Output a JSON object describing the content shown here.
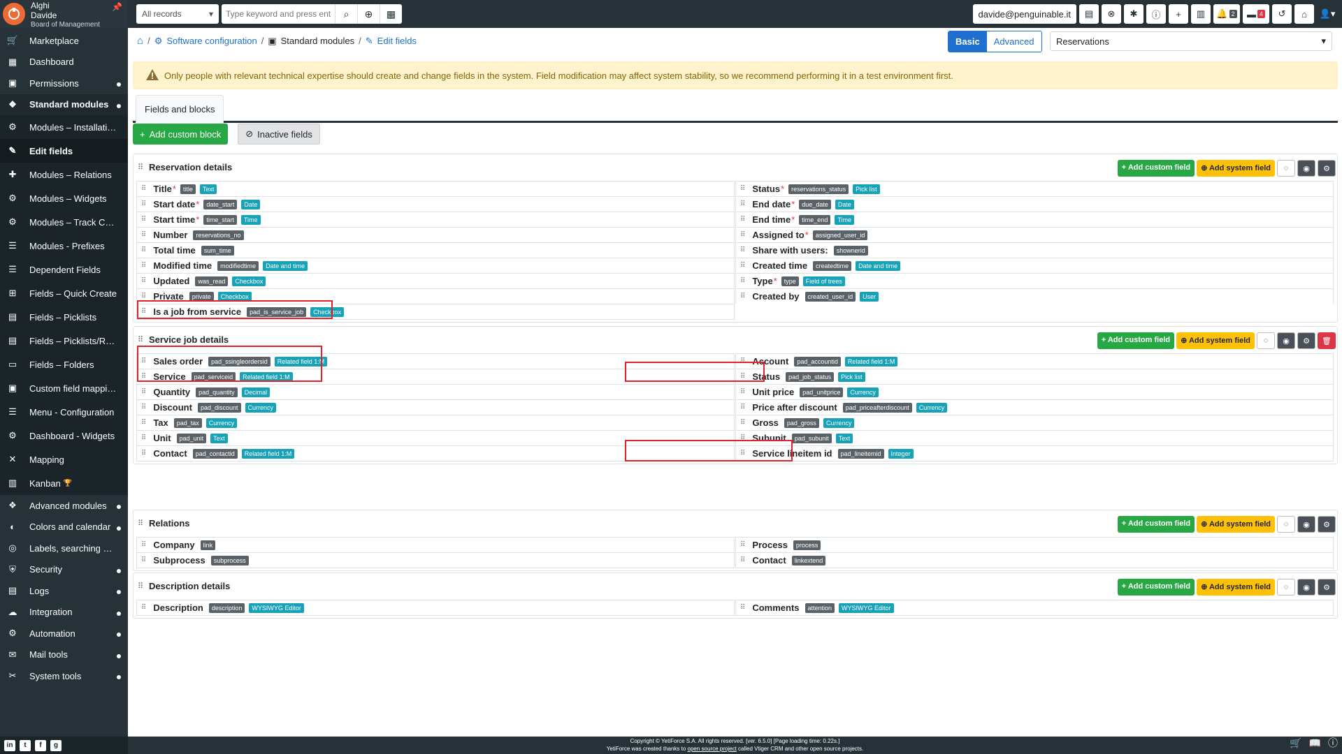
{
  "user": {
    "name1": "Alghi",
    "name2": "Davide",
    "role": "Board of Management"
  },
  "menu": [
    {
      "label": "Marketplace",
      "icon": "cart-icon",
      "dot": false,
      "type": "top"
    },
    {
      "label": "Dashboard",
      "icon": "dashboard-icon",
      "dot": false,
      "type": "top"
    },
    {
      "label": "Permissions",
      "icon": "briefcase-icon",
      "dot": true,
      "type": "top"
    },
    {
      "label": "Standard modules",
      "icon": "modules-icon",
      "dot": true,
      "type": "parent"
    },
    {
      "label": "Modules – Installation",
      "icon": "gear-cube-icon",
      "dot": false,
      "type": "sub"
    },
    {
      "label": "Edit fields",
      "icon": "edit-icon",
      "dot": false,
      "type": "cur"
    },
    {
      "label": "Modules – Relations",
      "icon": "puzzle-icon",
      "dot": false,
      "type": "sub"
    },
    {
      "label": "Modules – Widgets",
      "icon": "widgets-icon",
      "dot": false,
      "type": "sub"
    },
    {
      "label": "Modules – Track Chang…",
      "icon": "track-icon",
      "dot": false,
      "type": "sub"
    },
    {
      "label": "Modules - Prefixes",
      "icon": "prefix-icon",
      "dot": false,
      "type": "sub"
    },
    {
      "label": "Dependent Fields",
      "icon": "list-icon",
      "dot": false,
      "type": "sub"
    },
    {
      "label": "Fields – Quick Create",
      "icon": "plus-square-icon",
      "dot": false,
      "type": "sub"
    },
    {
      "label": "Fields – Picklists",
      "icon": "picklist-icon",
      "dot": false,
      "type": "sub"
    },
    {
      "label": "Fields – Picklists/Relati…",
      "icon": "picklist-relation-icon",
      "dot": false,
      "type": "sub"
    },
    {
      "label": "Fields – Folders",
      "icon": "folder-icon",
      "dot": false,
      "type": "sub"
    },
    {
      "label": "Custom field mapping",
      "icon": "mapping-icon",
      "dot": false,
      "type": "sub"
    },
    {
      "label": "Menu - Configuration",
      "icon": "menu-icon",
      "dot": false,
      "type": "sub"
    },
    {
      "label": "Dashboard - Widgets",
      "icon": "dashboard-widgets-icon",
      "dot": false,
      "type": "sub"
    },
    {
      "label": "Mapping",
      "icon": "arrows-icon",
      "dot": false,
      "type": "sub"
    },
    {
      "label": "Kanban",
      "icon": "kanban-icon",
      "dot": false,
      "type": "sub",
      "extra": "🏆"
    },
    {
      "label": "Advanced modules",
      "icon": "advanced-modules-icon",
      "dot": true,
      "type": "top"
    },
    {
      "label": "Colors and calendar",
      "icon": "palette-icon",
      "dot": true,
      "type": "top"
    },
    {
      "label": "Labels, searching a…",
      "icon": "labels-icon",
      "dot": false,
      "type": "top"
    },
    {
      "label": "Security",
      "icon": "shield-icon",
      "dot": true,
      "type": "top"
    },
    {
      "label": "Logs",
      "icon": "logs-icon",
      "dot": true,
      "type": "top"
    },
    {
      "label": "Integration",
      "icon": "cloud-icon",
      "dot": true,
      "type": "top"
    },
    {
      "label": "Automation",
      "icon": "gears-icon",
      "dot": true,
      "type": "top"
    },
    {
      "label": "Mail tools",
      "icon": "mail-icon",
      "dot": true,
      "type": "top"
    },
    {
      "label": "System tools",
      "icon": "tools-icon",
      "dot": true,
      "type": "top"
    }
  ],
  "topbar": {
    "records": "All records",
    "search_placeholder": "Type keyword and press enter",
    "email": "davide@penguinable.it",
    "notif_count": "2",
    "cal_count": "4"
  },
  "breadcrumb": {
    "l1": "Software configuration",
    "l2": "Standard modules",
    "l3": "Edit fields"
  },
  "mode": {
    "basic": "Basic",
    "advanced": "Advanced"
  },
  "module_select": "Reservations",
  "alert": "Only people with relevant technical expertise should create and change fields in the system. Field modification may affect system stability, so we recommend performing it in a test environment first.",
  "tab": "Fields and blocks",
  "actions": {
    "add_block": "Add custom block",
    "inactive": "Inactive fields"
  },
  "btn": {
    "custom": "Add custom field",
    "system": "Add system field"
  },
  "blocks": [
    {
      "title": "Reservation details",
      "del": false,
      "rows": [
        [
          {
            "n": "Title",
            "r": true,
            "c": "title",
            "t": "Text"
          },
          {
            "n": "Status",
            "r": true,
            "c": "reservations_status",
            "t": "Pick list"
          }
        ],
        [
          {
            "n": "Start date",
            "r": true,
            "c": "date_start",
            "t": "Date"
          },
          {
            "n": "End date",
            "r": true,
            "c": "due_date",
            "t": "Date"
          }
        ],
        [
          {
            "n": "Start time",
            "r": true,
            "c": "time_start",
            "t": "Time"
          },
          {
            "n": "End time",
            "r": true,
            "c": "time_end",
            "t": "Time"
          }
        ],
        [
          {
            "n": "Number",
            "r": false,
            "c": "reservations_no",
            "t": ""
          },
          {
            "n": "Assigned to",
            "r": true,
            "c": "assigned_user_id",
            "t": ""
          }
        ],
        [
          {
            "n": "Total time",
            "r": false,
            "c": "sum_time",
            "t": ""
          },
          {
            "n": "Share with users:",
            "r": false,
            "c": "shownerid",
            "t": ""
          }
        ],
        [
          {
            "n": "Modified time",
            "r": false,
            "c": "modifiedtime",
            "t": "Date and time"
          },
          {
            "n": "Created time",
            "r": false,
            "c": "createdtime",
            "t": "Date and time"
          }
        ],
        [
          {
            "n": "Updated",
            "r": false,
            "c": "was_read",
            "t": "Checkbox"
          },
          {
            "n": "Type",
            "r": true,
            "c": "type",
            "t": "Field of trees"
          }
        ],
        [
          {
            "n": "Private",
            "r": false,
            "c": "private",
            "t": "Checkbox"
          },
          {
            "n": "Created by",
            "r": false,
            "c": "created_user_id",
            "t": "User"
          }
        ],
        [
          {
            "n": "Is a job from service",
            "r": false,
            "c": "pad_is_service_job",
            "t": "Checkbox"
          },
          null
        ]
      ]
    },
    {
      "title": "Service job details",
      "del": true,
      "rows": [
        [
          {
            "n": "Sales order",
            "r": false,
            "c": "pad_ssingleordersid",
            "t": "Related field 1:M"
          },
          {
            "n": "Account",
            "r": false,
            "c": "pad_accountid",
            "t": "Related field 1:M"
          }
        ],
        [
          {
            "n": "Service",
            "r": false,
            "c": "pad_serviceid",
            "t": "Related field 1:M"
          },
          {
            "n": "Status",
            "r": false,
            "c": "pad_job_status",
            "t": "Pick list"
          }
        ],
        [
          {
            "n": "Quantity",
            "r": false,
            "c": "pad_quantity",
            "t": "Decimal"
          },
          {
            "n": "Unit price",
            "r": false,
            "c": "pad_unitprice",
            "t": "Currency"
          }
        ],
        [
          {
            "n": "Discount",
            "r": false,
            "c": "pad_discount",
            "t": "Currency"
          },
          {
            "n": "Price after discount",
            "r": false,
            "c": "pad_priceafterdiscount",
            "t": "Currency"
          }
        ],
        [
          {
            "n": "Tax",
            "r": false,
            "c": "pad_tax",
            "t": "Currency"
          },
          {
            "n": "Gross",
            "r": false,
            "c": "pad_gross",
            "t": "Currency"
          }
        ],
        [
          {
            "n": "Unit",
            "r": false,
            "c": "pad_unit",
            "t": "Text"
          },
          {
            "n": "Subunit",
            "r": false,
            "c": "pad_subunit",
            "t": "Text"
          }
        ],
        [
          {
            "n": "Contact",
            "r": false,
            "c": "pad_contactid",
            "t": "Related field 1:M"
          },
          {
            "n": "Service lineitem id",
            "r": false,
            "c": "pad_lineitemid",
            "t": "Integer"
          }
        ]
      ]
    },
    {
      "title": "Relations",
      "del": false,
      "rows": [
        [
          {
            "n": "Company",
            "r": false,
            "c": "link",
            "t": ""
          },
          {
            "n": "Process",
            "r": false,
            "c": "process",
            "t": ""
          }
        ],
        [
          {
            "n": "Subprocess",
            "r": false,
            "c": "subprocess",
            "t": ""
          },
          {
            "n": "Contact",
            "r": false,
            "c": "linkextend",
            "t": ""
          }
        ]
      ]
    },
    {
      "title": "Description details",
      "del": false,
      "rows": [
        [
          {
            "n": "Description",
            "r": false,
            "c": "description",
            "t": "WYSIWYG Editor"
          },
          {
            "n": "Comments",
            "r": false,
            "c": "attention",
            "t": "WYSIWYG Editor"
          }
        ]
      ]
    }
  ],
  "footer": {
    "line1": "Copyright © YetiForce S.A. All rights reserved. [ver. 6.5.0] [Page loading time: 0.22s.]",
    "line2a": "YetiForce was created thanks to ",
    "line2b": "open source project",
    "line2c": " called Vtiger CRM and other open source projects."
  }
}
